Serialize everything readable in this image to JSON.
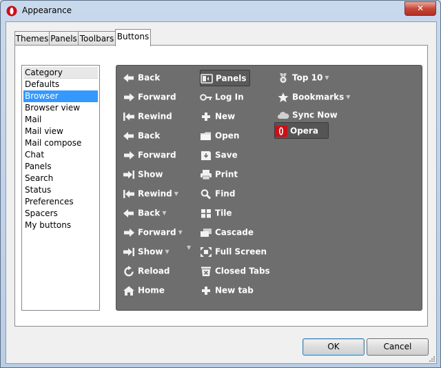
{
  "window": {
    "title": "Appearance",
    "close_label": "✕"
  },
  "tabs": [
    "Themes",
    "Panels",
    "Toolbars",
    "Buttons"
  ],
  "active_tab": "Buttons",
  "categories": {
    "header": "Category",
    "items": [
      "Defaults",
      "Browser",
      "Browser view",
      "Mail",
      "Mail view",
      "Mail compose",
      "Chat",
      "Panels",
      "Search",
      "Status",
      "Preferences",
      "Spacers",
      "My buttons"
    ],
    "selected": "Browser"
  },
  "button_grid": {
    "col1": [
      {
        "label": "Back",
        "icon": "arrow-left-icon"
      },
      {
        "label": "Forward",
        "icon": "arrow-right-icon"
      },
      {
        "label": "Rewind",
        "icon": "rewind-icon"
      },
      {
        "label": "Back",
        "icon": "arrow-left-icon"
      },
      {
        "label": "Forward",
        "icon": "arrow-right-icon"
      },
      {
        "label": "Show",
        "icon": "fast-forward-icon"
      },
      {
        "label": "Rewind",
        "icon": "rewind-icon",
        "dropdown": true
      },
      {
        "label": "Back",
        "icon": "arrow-left-icon",
        "dropdown": true
      },
      {
        "label": "Forward",
        "icon": "arrow-right-icon",
        "dropdown": true
      },
      {
        "label": "Show",
        "icon": "fast-forward-icon",
        "dropdown": true
      },
      {
        "label": "Reload",
        "icon": "reload-icon"
      },
      {
        "label": "Home",
        "icon": "home-icon"
      }
    ],
    "col2": [
      {
        "label": "Panels",
        "icon": "panels-icon"
      },
      {
        "label": "Log In",
        "icon": "key-icon"
      },
      {
        "label": "New",
        "icon": "plus-icon"
      },
      {
        "label": "Open",
        "icon": "folder-icon"
      },
      {
        "label": "Save",
        "icon": "save-icon"
      },
      {
        "label": "Print",
        "icon": "printer-icon"
      },
      {
        "label": "Find",
        "icon": "magnifier-icon"
      },
      {
        "label": "Tile",
        "icon": "tile-icon"
      },
      {
        "label": "Cascade",
        "icon": "cascade-icon"
      },
      {
        "label": "Full Screen",
        "icon": "fullscreen-icon"
      },
      {
        "label": "Closed Tabs",
        "icon": "trash-icon"
      },
      {
        "label": "New tab",
        "icon": "plus-icon"
      }
    ],
    "col3": [
      {
        "label": "Top 10",
        "icon": "medal-icon",
        "dropdown": true
      },
      {
        "label": "Bookmarks",
        "icon": "star-icon",
        "dropdown": true
      },
      {
        "label": "Sync Now",
        "icon": "cloud-icon"
      },
      {
        "label": "Opera",
        "icon": "opera-logo-icon"
      }
    ]
  },
  "footer": {
    "ok_label": "OK",
    "cancel_label": "Cancel"
  },
  "colors": {
    "selection": "#3399ff",
    "grid_bg": "#6e6e6e",
    "opera_red": "#cc0f16"
  }
}
